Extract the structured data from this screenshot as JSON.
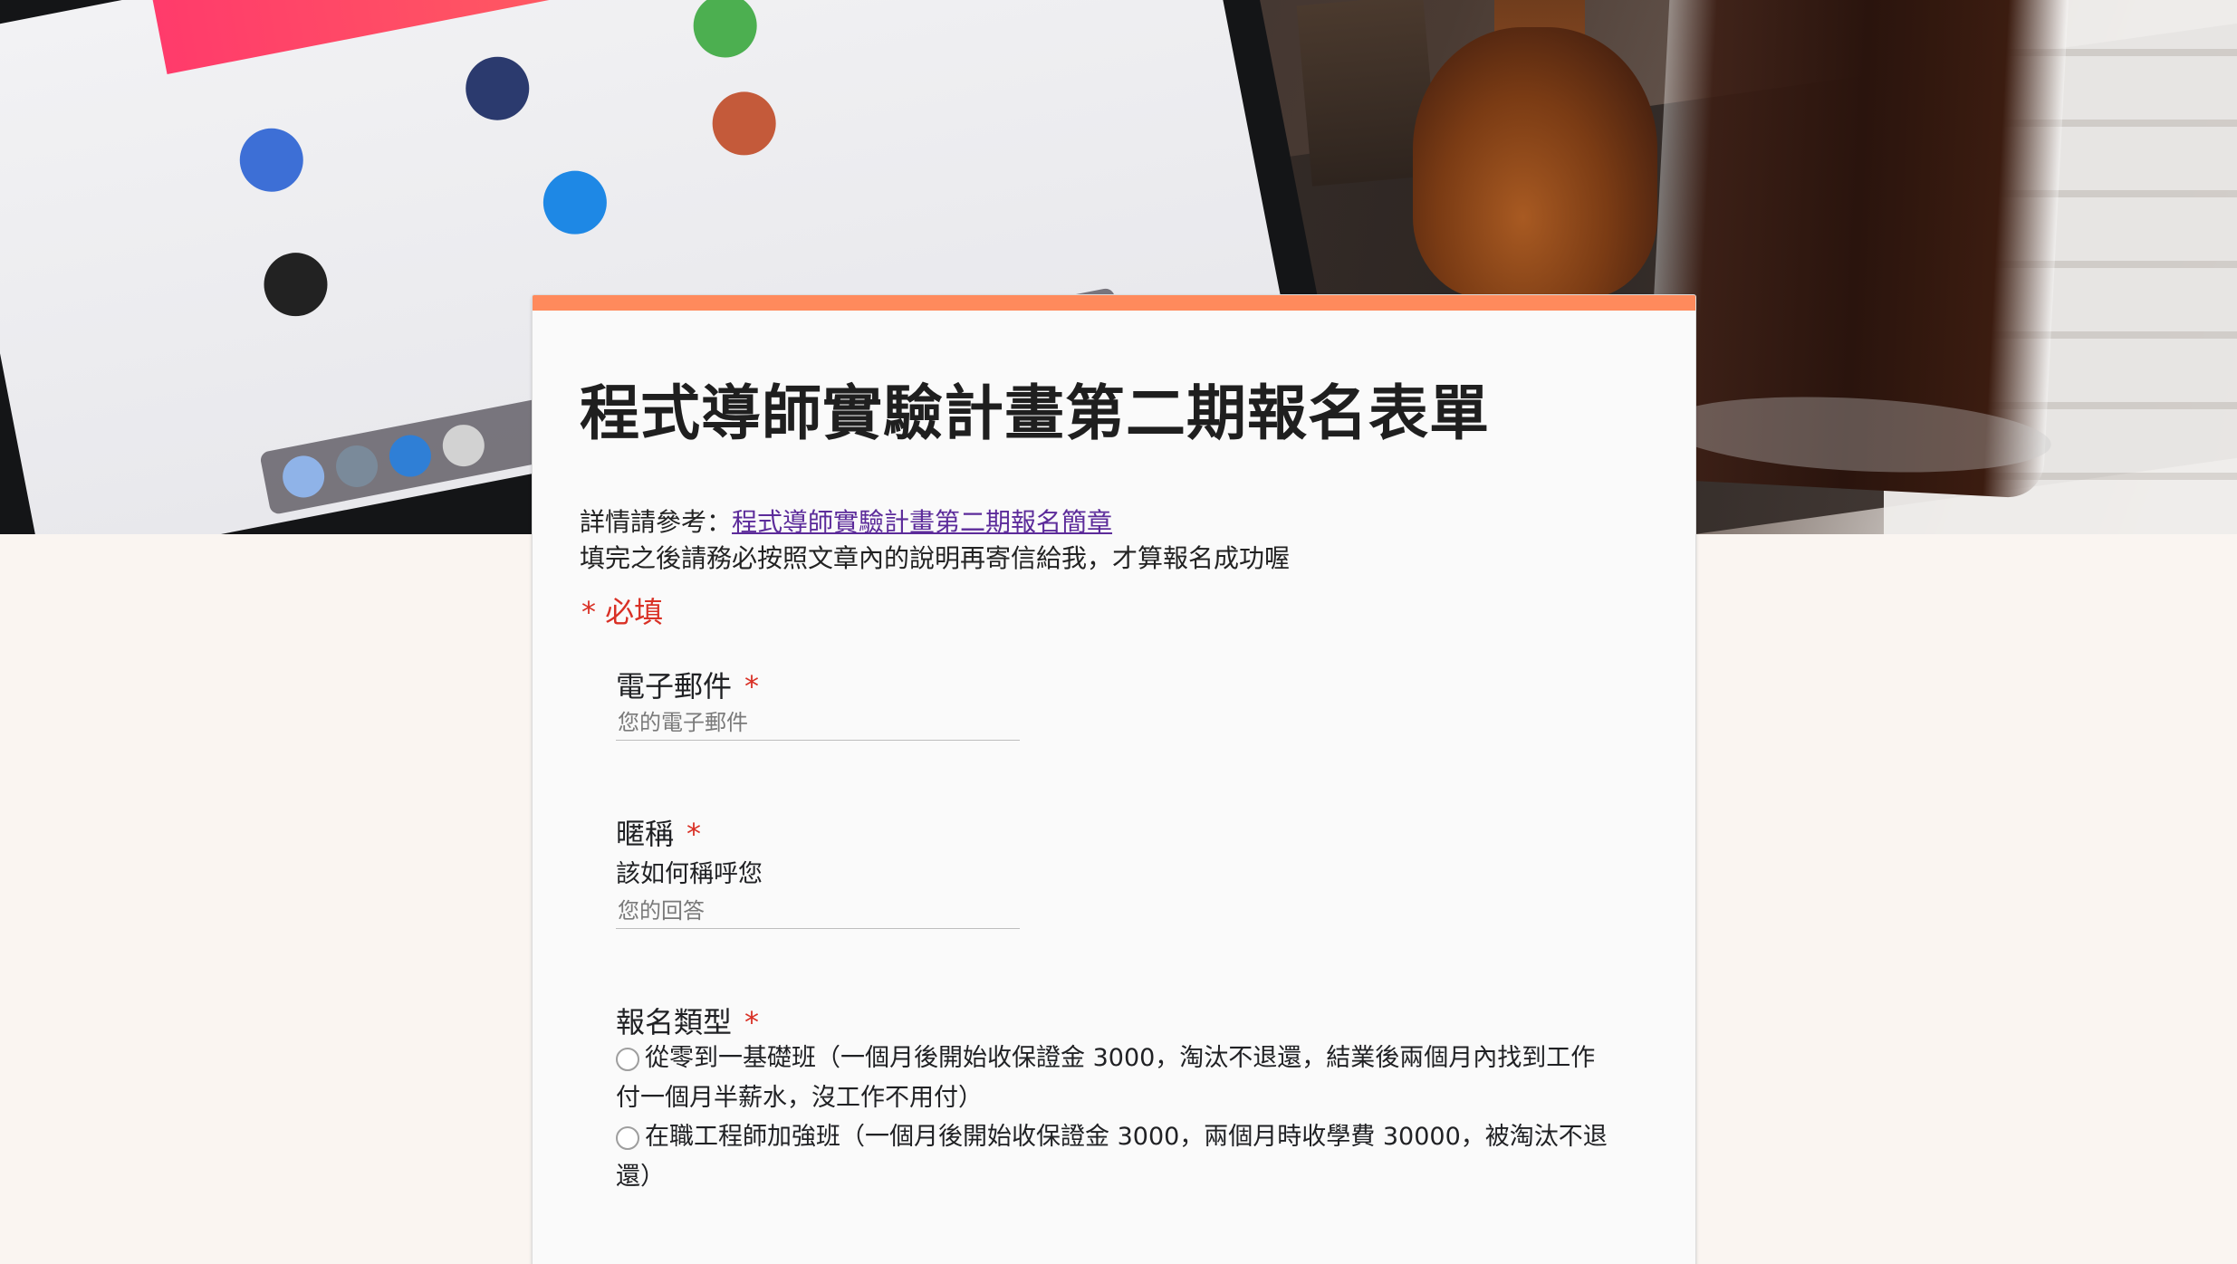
{
  "form": {
    "title": "程式導師實驗計畫第二期報名表單",
    "description": {
      "prefix": "詳情請參考：",
      "link_text": "程式導師實驗計畫第二期報名簡章",
      "line2": "填完之後請務必按照文章內的說明再寄信給我，才算報名成功喔"
    },
    "required_note": "* 必填",
    "accent_color": "#ff8a5c",
    "required_color": "#d93025",
    "questions": [
      {
        "title": "電子郵件",
        "required_mark": "*",
        "placeholder": "您的電子郵件",
        "value": ""
      },
      {
        "title": "暱稱",
        "required_mark": "*",
        "help_text": "該如何稱呼您",
        "placeholder": "您的回答",
        "value": ""
      },
      {
        "title": "報名類型",
        "required_mark": "*",
        "options": [
          "從零到一基礎班（一個月後開始收保證金 3000，淘汰不退還，結業後兩個月內找到工作付一個月半薪水，沒工作不用付）",
          "在職工程師加強班（一個月後開始收保證金 3000，兩個月時收學費 30000，被淘汰不退還）"
        ]
      }
    ]
  },
  "header_image": {
    "subject": "laptop-and-iced-coffee-photo"
  }
}
